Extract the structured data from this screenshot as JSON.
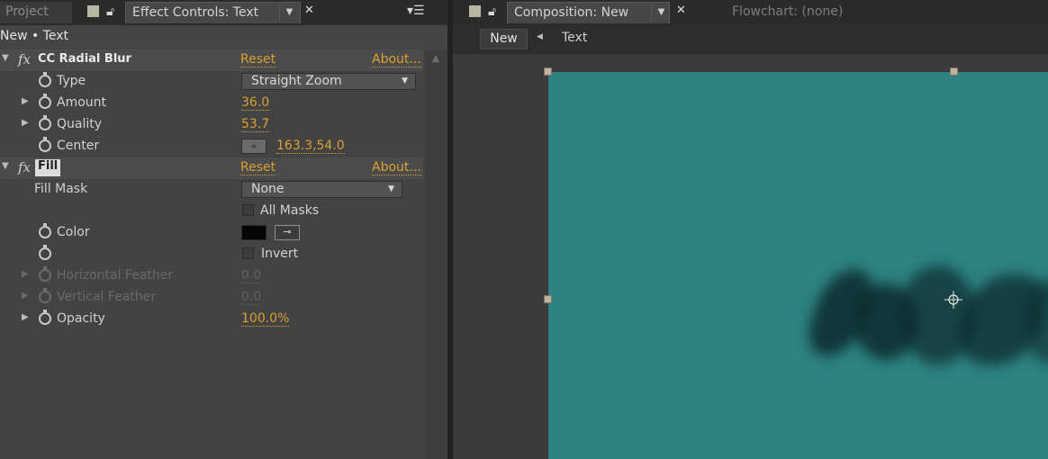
{
  "left_panel": {
    "tabs": {
      "project": "Project",
      "effect_controls": "Effect Controls: Text"
    },
    "breadcrumb": "New • Text",
    "effects": [
      {
        "name": "CC Radial Blur",
        "reset": "Reset",
        "about": "About...",
        "properties": {
          "type_label": "Type",
          "type_value": "Straight Zoom",
          "amount_label": "Amount",
          "amount_value": "36.0",
          "quality_label": "Quality",
          "quality_value": "53.7",
          "center_label": "Center",
          "center_value": "163.3,54.0"
        }
      },
      {
        "name": "Fill",
        "reset": "Reset",
        "about": "About...",
        "properties": {
          "fill_mask_label": "Fill Mask",
          "fill_mask_value": "None",
          "all_masks_label": "All Masks",
          "color_label": "Color",
          "color_value": "#000000",
          "invert_label": "Invert",
          "h_feather_label": "Horizontal Feather",
          "h_feather_value": "0.0",
          "v_feather_label": "Vertical Feather",
          "v_feather_value": "0.0",
          "opacity_label": "Opacity",
          "opacity_value": "100.0%"
        }
      }
    ]
  },
  "right_panel": {
    "tabs": {
      "composition": "Composition: New",
      "flowchart": "Flowchart: (none)"
    },
    "nav": {
      "button": "New",
      "crumb": "Text"
    }
  },
  "colors": {
    "accent": "#d9a033",
    "comp_background": "#2d8282",
    "panel": "#434343"
  },
  "icons": {
    "stopwatch": "stopwatch-icon",
    "lock": "lock-icon",
    "close": "close-icon",
    "menu": "panel-menu-icon",
    "target": "point-control-icon",
    "eyedropper": "eyedropper-icon"
  }
}
